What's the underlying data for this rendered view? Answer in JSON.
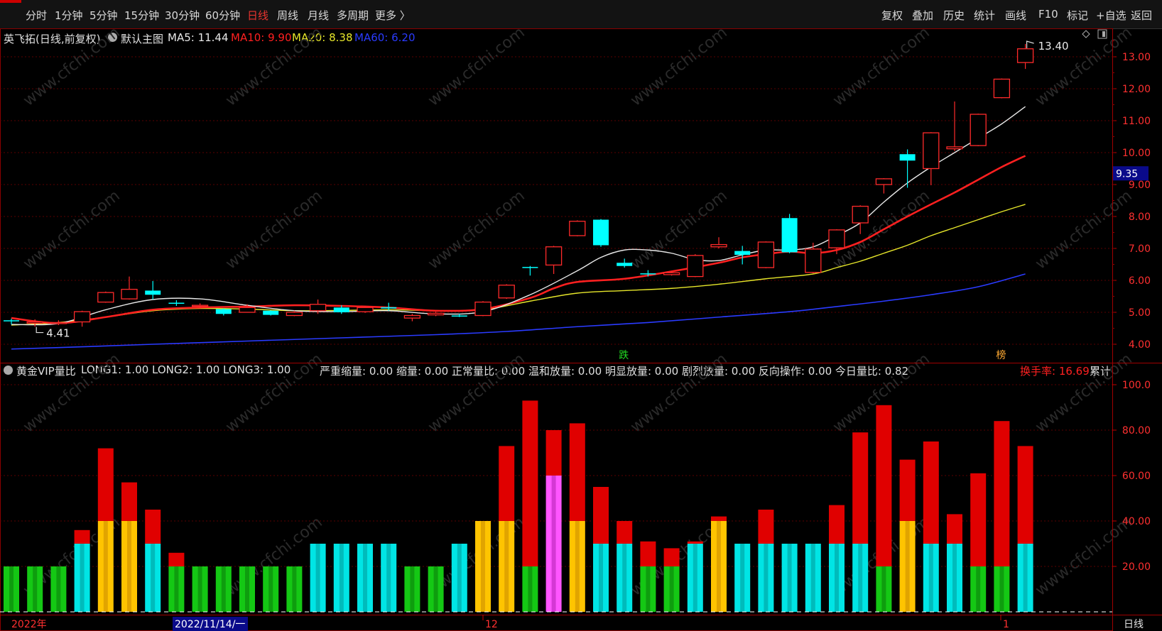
{
  "toolbar": {
    "left_tabs": [
      "分时",
      "1分钟",
      "5分钟",
      "15分钟",
      "30分钟",
      "60分钟",
      "日线",
      "周线",
      "月线",
      "多周期",
      "更多 〉"
    ],
    "active_tab": "日线",
    "right_buttons": [
      "复权",
      "叠加",
      "历史",
      "统计",
      "画线",
      "F10",
      "标记",
      "+自选",
      "返回"
    ]
  },
  "main_chart": {
    "stock_name": "英飞拓(日线,前复权)",
    "template": "默认主图",
    "ma": [
      {
        "label": "MA5: 11.44",
        "color": "#e8e8e8"
      },
      {
        "label": "MA10: 9.90",
        "color": "#ff2020"
      },
      {
        "label": "MA20: 8.38",
        "color": "#e6e62a"
      },
      {
        "label": "MA60: 6.20",
        "color": "#2a3bff"
      }
    ],
    "price_axis": [
      "13.00",
      "12.00",
      "11.00",
      "10.00",
      "9.00",
      "8.00",
      "7.00",
      "6.00",
      "5.00",
      "4.00"
    ],
    "current_price_tag": "9.35",
    "high_label": "13.40",
    "low_label": "4.41",
    "marker_fall": "跌",
    "marker_rank": "榜"
  },
  "volume_panel": {
    "indicator_name": "黄金VIP量比",
    "params": "LONG1: 1.00  LONG2: 1.00  LONG3: 1.00",
    "stats": "严重缩量: 0.00  缩量: 0.00  正常量比: 0.00  温和放量: 0.00  明显放量: 0.00  剧烈放量: 0.00  反向操作: 0.00  今日量比: 0.82",
    "turnover": "换手率: 16.69",
    "cumulative": "累计",
    "axis": [
      "100.0",
      "80.00",
      "60.00",
      "40.00",
      "20.00"
    ]
  },
  "date_axis": {
    "year_label": "2022年",
    "cursor_date": "2022/11/14/一",
    "month_12": "12",
    "month_1": "1",
    "period_label": "日线"
  },
  "watermark": "www.cfchi.com",
  "chart_data": {
    "type": "candlestick",
    "candles": [
      {
        "o": 4.75,
        "c": 4.72,
        "h": 4.8,
        "l": 4.62
      },
      {
        "o": 4.66,
        "c": 4.7,
        "h": 4.78,
        "l": 4.55
      },
      {
        "o": 4.66,
        "c": 4.68,
        "h": 4.75,
        "l": 4.6
      },
      {
        "o": 4.7,
        "c": 5.02,
        "h": 5.05,
        "l": 4.55
      },
      {
        "o": 5.32,
        "c": 5.62,
        "h": 5.65,
        "l": 5.3
      },
      {
        "o": 5.42,
        "c": 5.72,
        "h": 6.12,
        "l": 5.4
      },
      {
        "o": 5.68,
        "c": 5.55,
        "h": 5.98,
        "l": 5.4
      },
      {
        "o": 5.3,
        "c": 5.28,
        "h": 5.38,
        "l": 5.2
      },
      {
        "o": 5.2,
        "c": 5.22,
        "h": 5.28,
        "l": 5.12
      },
      {
        "o": 5.1,
        "c": 4.95,
        "h": 5.12,
        "l": 4.9
      },
      {
        "o": 5.0,
        "c": 5.15,
        "h": 5.25,
        "l": 5.0
      },
      {
        "o": 5.05,
        "c": 4.92,
        "h": 5.06,
        "l": 4.9
      },
      {
        "o": 4.9,
        "c": 5.0,
        "h": 5.05,
        "l": 4.88
      },
      {
        "o": 5.05,
        "c": 5.25,
        "h": 5.4,
        "l": 4.95
      },
      {
        "o": 5.15,
        "c": 5.0,
        "h": 5.22,
        "l": 4.95
      },
      {
        "o": 5.02,
        "c": 5.15,
        "h": 5.2,
        "l": 4.98
      },
      {
        "o": 5.16,
        "c": 5.12,
        "h": 5.3,
        "l": 5.05
      },
      {
        "o": 4.82,
        "c": 4.9,
        "h": 4.95,
        "l": 4.72
      },
      {
        "o": 4.92,
        "c": 4.97,
        "h": 5.02,
        "l": 4.88
      },
      {
        "o": 4.9,
        "c": 4.88,
        "h": 4.95,
        "l": 4.85
      },
      {
        "o": 4.9,
        "c": 5.32,
        "h": 5.35,
        "l": 4.88
      },
      {
        "o": 5.45,
        "c": 5.85,
        "h": 5.88,
        "l": 5.42
      },
      {
        "o": 6.42,
        "c": 6.4,
        "h": 6.45,
        "l": 6.15
      },
      {
        "o": 6.48,
        "c": 7.05,
        "h": 7.08,
        "l": 6.2
      },
      {
        "o": 7.4,
        "c": 7.85,
        "h": 7.88,
        "l": 7.38
      },
      {
        "o": 7.9,
        "c": 7.1,
        "h": 7.92,
        "l": 7.05
      },
      {
        "o": 6.55,
        "c": 6.45,
        "h": 6.68,
        "l": 6.4
      },
      {
        "o": 6.22,
        "c": 6.2,
        "h": 6.32,
        "l": 6.12
      },
      {
        "o": 6.18,
        "c": 6.24,
        "h": 6.3,
        "l": 6.15
      },
      {
        "o": 6.12,
        "c": 6.78,
        "h": 6.82,
        "l": 6.1
      },
      {
        "o": 7.05,
        "c": 7.12,
        "h": 7.35,
        "l": 7.0
      },
      {
        "o": 6.92,
        "c": 6.8,
        "h": 7.08,
        "l": 6.5
      },
      {
        "o": 6.4,
        "c": 7.2,
        "h": 7.22,
        "l": 6.38
      },
      {
        "o": 7.95,
        "c": 6.88,
        "h": 8.08,
        "l": 6.85
      },
      {
        "o": 6.25,
        "c": 6.98,
        "h": 7.18,
        "l": 6.22
      },
      {
        "o": 7.02,
        "c": 7.58,
        "h": 7.6,
        "l": 6.82
      },
      {
        "o": 7.8,
        "c": 8.32,
        "h": 8.35,
        "l": 7.45
      },
      {
        "o": 9.0,
        "c": 9.18,
        "h": 9.2,
        "l": 8.72
      },
      {
        "o": 9.95,
        "c": 9.75,
        "h": 10.1,
        "l": 8.9
      },
      {
        "o": 9.5,
        "c": 10.62,
        "h": 10.64,
        "l": 8.98
      },
      {
        "o": 10.12,
        "c": 10.18,
        "h": 11.6,
        "l": 10.05
      },
      {
        "o": 10.22,
        "c": 11.2,
        "h": 11.22,
        "l": 10.2
      },
      {
        "o": 11.72,
        "c": 12.3,
        "h": 12.32,
        "l": 11.7
      },
      {
        "o": 12.82,
        "c": 13.25,
        "h": 13.4,
        "l": 12.62
      }
    ],
    "ma5": [
      [
        0,
        4.62
      ],
      [
        2,
        4.65
      ],
      [
        4,
        5.08
      ],
      [
        6,
        5.4
      ],
      [
        8,
        5.42
      ],
      [
        10,
        5.22
      ],
      [
        12,
        5.05
      ],
      [
        14,
        5.02
      ],
      [
        16,
        5.05
      ],
      [
        18,
        4.95
      ],
      [
        20,
        5.02
      ],
      [
        22,
        5.55
      ],
      [
        24,
        6.3
      ],
      [
        25,
        6.72
      ],
      [
        26,
        6.95
      ],
      [
        27,
        6.95
      ],
      [
        28,
        6.85
      ],
      [
        29,
        6.65
      ],
      [
        30,
        6.62
      ],
      [
        31,
        6.8
      ],
      [
        32,
        6.95
      ],
      [
        33,
        6.95
      ],
      [
        34,
        7.05
      ],
      [
        35,
        7.4
      ],
      [
        36,
        7.8
      ],
      [
        37,
        8.45
      ],
      [
        38,
        9.05
      ],
      [
        39,
        9.55
      ],
      [
        40,
        10.0
      ],
      [
        41,
        10.45
      ],
      [
        42,
        10.9
      ],
      [
        43,
        11.44
      ]
    ],
    "ma10": [
      [
        0,
        4.82
      ],
      [
        2,
        4.66
      ],
      [
        4,
        4.85
      ],
      [
        6,
        5.08
      ],
      [
        8,
        5.15
      ],
      [
        10,
        5.18
      ],
      [
        12,
        5.22
      ],
      [
        14,
        5.2
      ],
      [
        16,
        5.15
      ],
      [
        18,
        5.05
      ],
      [
        20,
        5.1
      ],
      [
        22,
        5.45
      ],
      [
        23,
        5.75
      ],
      [
        24,
        5.95
      ],
      [
        26,
        6.05
      ],
      [
        28,
        6.28
      ],
      [
        30,
        6.55
      ],
      [
        31,
        6.72
      ],
      [
        32,
        6.82
      ],
      [
        33,
        6.9
      ],
      [
        34,
        6.85
      ],
      [
        35,
        6.95
      ],
      [
        36,
        7.2
      ],
      [
        37,
        7.6
      ],
      [
        38,
        8.0
      ],
      [
        39,
        8.38
      ],
      [
        40,
        8.75
      ],
      [
        41,
        9.15
      ],
      [
        42,
        9.55
      ],
      [
        43,
        9.9
      ]
    ],
    "ma20": [
      [
        0,
        4.6
      ],
      [
        2,
        4.68
      ],
      [
        4,
        4.85
      ],
      [
        6,
        5.05
      ],
      [
        8,
        5.12
      ],
      [
        10,
        5.1
      ],
      [
        12,
        5.05
      ],
      [
        14,
        5.06
      ],
      [
        16,
        5.08
      ],
      [
        18,
        5.05
      ],
      [
        20,
        5.08
      ],
      [
        22,
        5.35
      ],
      [
        24,
        5.6
      ],
      [
        26,
        5.68
      ],
      [
        28,
        5.75
      ],
      [
        30,
        5.88
      ],
      [
        32,
        6.05
      ],
      [
        34,
        6.2
      ],
      [
        35,
        6.4
      ],
      [
        36,
        6.6
      ],
      [
        37,
        6.85
      ],
      [
        38,
        7.1
      ],
      [
        39,
        7.4
      ],
      [
        40,
        7.65
      ],
      [
        41,
        7.9
      ],
      [
        42,
        8.15
      ],
      [
        43,
        8.38
      ]
    ],
    "ma60": [
      [
        0,
        3.85
      ],
      [
        3,
        3.92
      ],
      [
        6,
        4.0
      ],
      [
        10,
        4.1
      ],
      [
        14,
        4.2
      ],
      [
        18,
        4.3
      ],
      [
        21,
        4.4
      ],
      [
        24,
        4.55
      ],
      [
        27,
        4.68
      ],
      [
        30,
        4.85
      ],
      [
        33,
        5.02
      ],
      [
        35,
        5.18
      ],
      [
        37,
        5.35
      ],
      [
        39,
        5.55
      ],
      [
        41,
        5.8
      ],
      [
        43,
        6.2
      ]
    ],
    "volume_bars": [
      {
        "total": 20,
        "base": 20,
        "style": "green"
      },
      {
        "total": 20,
        "base": 20,
        "style": "green"
      },
      {
        "total": 20,
        "base": 20,
        "style": "green"
      },
      {
        "total": 36,
        "base": 30,
        "style": "cyan"
      },
      {
        "total": 72,
        "base": 40,
        "style": "orange"
      },
      {
        "total": 57,
        "base": 40,
        "style": "orange"
      },
      {
        "total": 45,
        "base": 30,
        "style": "cyan"
      },
      {
        "total": 26,
        "base": 20,
        "style": "green"
      },
      {
        "total": 20,
        "base": 20,
        "style": "green"
      },
      {
        "total": 20,
        "base": 20,
        "style": "green"
      },
      {
        "total": 20,
        "base": 20,
        "style": "green"
      },
      {
        "total": 20,
        "base": 20,
        "style": "green"
      },
      {
        "total": 20,
        "base": 20,
        "style": "green"
      },
      {
        "total": 30,
        "base": 30,
        "style": "cyan"
      },
      {
        "total": 30,
        "base": 30,
        "style": "cyan"
      },
      {
        "total": 30,
        "base": 30,
        "style": "cyan"
      },
      {
        "total": 30,
        "base": 30,
        "style": "cyan"
      },
      {
        "total": 20,
        "base": 20,
        "style": "green"
      },
      {
        "total": 20,
        "base": 20,
        "style": "green"
      },
      {
        "total": 30,
        "base": 30,
        "style": "cyan"
      },
      {
        "total": 40,
        "base": 40,
        "style": "orange"
      },
      {
        "total": 73,
        "base": 40,
        "style": "orange"
      },
      {
        "total": 93,
        "base": 20,
        "style": "green"
      },
      {
        "total": 80,
        "base": 60,
        "style": "magenta"
      },
      {
        "total": 83,
        "base": 40,
        "style": "orange"
      },
      {
        "total": 55,
        "base": 30,
        "style": "cyan"
      },
      {
        "total": 40,
        "base": 30,
        "style": "cyan"
      },
      {
        "total": 31,
        "base": 20,
        "style": "green"
      },
      {
        "total": 28,
        "base": 20,
        "style": "green"
      },
      {
        "total": 31,
        "base": 30,
        "style": "cyan"
      },
      {
        "total": 42,
        "base": 40,
        "style": "orange"
      },
      {
        "total": 30,
        "base": 30,
        "style": "cyan"
      },
      {
        "total": 45,
        "base": 30,
        "style": "cyan"
      },
      {
        "total": 30,
        "base": 30,
        "style": "cyan"
      },
      {
        "total": 30,
        "base": 30,
        "style": "cyan"
      },
      {
        "total": 47,
        "base": 30,
        "style": "cyan"
      },
      {
        "total": 79,
        "base": 30,
        "style": "cyan"
      },
      {
        "total": 91,
        "base": 20,
        "style": "green"
      },
      {
        "total": 67,
        "base": 40,
        "style": "orange"
      },
      {
        "total": 75,
        "base": 30,
        "style": "cyan"
      },
      {
        "total": 43,
        "base": 30,
        "style": "cyan"
      },
      {
        "total": 61,
        "base": 20,
        "style": "green"
      },
      {
        "total": 84,
        "base": 20,
        "style": "green"
      },
      {
        "total": 73,
        "base": 30,
        "style": "cyan"
      }
    ],
    "price_range": [
      3.7,
      13.9
    ],
    "volume_range": [
      0,
      100
    ]
  }
}
